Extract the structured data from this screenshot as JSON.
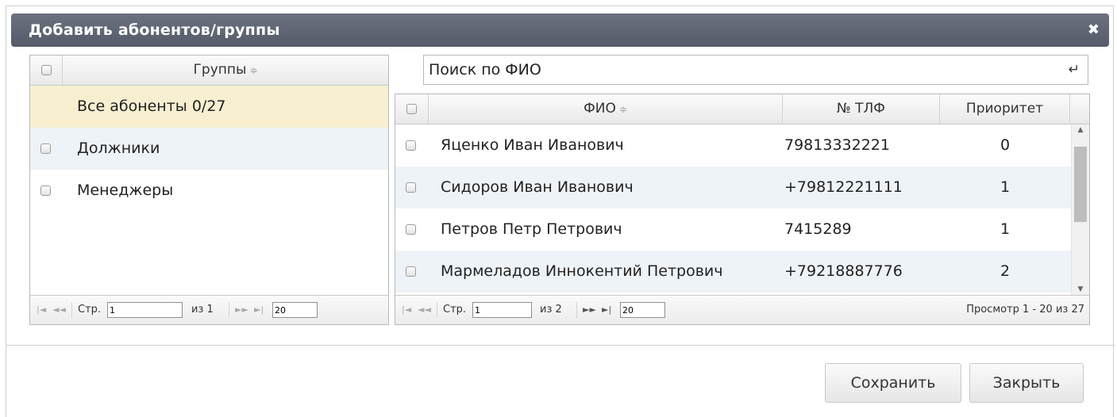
{
  "dialog": {
    "title": "Добавить абонентов/группы",
    "close_glyph": "✖"
  },
  "groups": {
    "header": "Группы",
    "rows": [
      {
        "name": "Все абоненты 0/27",
        "has_checkbox": false,
        "highlight": "#f7efd0"
      },
      {
        "name": "Должники",
        "has_checkbox": true,
        "highlight": "#eef3f8"
      },
      {
        "name": "Менеджеры",
        "has_checkbox": true,
        "highlight": "#ffffff"
      }
    ],
    "pager": {
      "page_label": "Стр.",
      "page_value": "1",
      "of_label": "из 1",
      "rows_value": "20"
    }
  },
  "search": {
    "placeholder": "Поиск по ФИО",
    "enter_glyph": "↵"
  },
  "subscribers": {
    "columns": [
      "ФИО",
      "№ ТЛФ",
      "Приоритет"
    ],
    "rows": [
      {
        "fio": "Яценко Иван Иванович",
        "phone": "79813332221",
        "priority": "0"
      },
      {
        "fio": "Сидоров Иван Иванович",
        "phone": "+79812221111",
        "priority": "1"
      },
      {
        "fio": "Петров Петр Петрович",
        "phone": "7415289",
        "priority": "1"
      },
      {
        "fio": "Мармеладов Иннокентий Петрович",
        "phone": "+79218887776",
        "priority": "2"
      }
    ],
    "pager": {
      "page_label": "Стр.",
      "page_value": "1",
      "of_label": "из 2",
      "rows_value": "20",
      "view_info": "Просмотр 1 - 20 из 27"
    }
  },
  "buttons": {
    "save": "Сохранить",
    "close": "Закрыть"
  },
  "colors": {
    "titlebar": "#5f6573",
    "selected_row": "#f7efd0",
    "alt_row": "#eef3f8"
  }
}
